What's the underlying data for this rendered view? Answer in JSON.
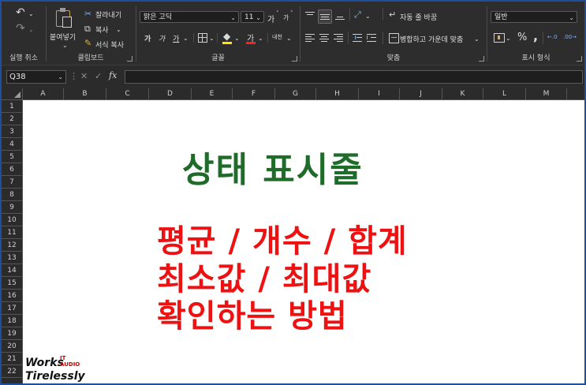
{
  "ribbon": {
    "undo_group_label": "실행 취소",
    "clipboard": {
      "label": "클립보드",
      "paste": "붙여넣기",
      "cut": "잘라내기",
      "copy": "복사",
      "format_painter": "서식 복사"
    },
    "font": {
      "label": "글꼴",
      "font_name": "맑은 고딕",
      "font_size": "11",
      "grow": "가",
      "shrink": "가",
      "bold": "가",
      "italic": "가",
      "underline": "가",
      "font_color_glyph": "가",
      "phonetic": "내천"
    },
    "alignment": {
      "label": "맞춤",
      "wrap": "자동 줄 바꿈",
      "merge": "병합하고 가운데 맞춤"
    },
    "number": {
      "label": "표시 형식",
      "format": "일반",
      "percent": "%",
      "comma": ","
    }
  },
  "formula_bar": {
    "name_box": "Q38",
    "fx": "fx",
    "value": ""
  },
  "grid": {
    "columns": [
      "A",
      "B",
      "C",
      "D",
      "E",
      "F",
      "G",
      "H",
      "I",
      "J",
      "K",
      "L",
      "M"
    ],
    "rows": [
      "1",
      "2",
      "3",
      "4",
      "5",
      "6",
      "7",
      "8",
      "9",
      "10",
      "11",
      "12",
      "13",
      "14",
      "15",
      "16",
      "17",
      "18",
      "19",
      "20",
      "21",
      "22"
    ]
  },
  "content": {
    "title": "상태 표시줄",
    "line1": "평균 / 개수 / 합계",
    "line2": "최소값 / 최대값",
    "line3": "확인하는 방법",
    "title_color": "#1f6b2a",
    "text_color": "#ee1111"
  },
  "logo": {
    "line1": "Works",
    "line2": "Tirelessly",
    "tag1": "IT",
    "tag2": "AUDIO"
  }
}
